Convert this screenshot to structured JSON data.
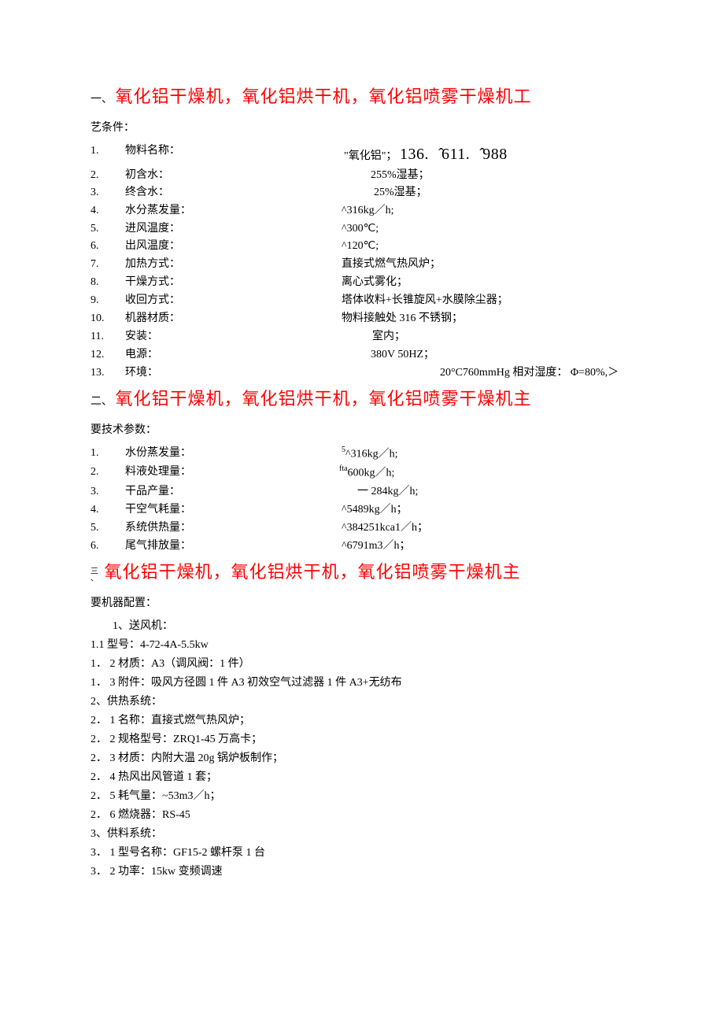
{
  "section1": {
    "prefix": "一、",
    "title": "氧化铝干燥机，氧化铝烘干机，氧化铝喷雾干燥机工",
    "subtitle": "艺条件：",
    "items": [
      {
        "num": "1.",
        "label": "物料名称：",
        "value_pre": "\"氧化铝\"；",
        "value_special": "136.一̂611.二̂988"
      },
      {
        "num": "2.",
        "label": "初含水：",
        "value": "255%湿基；"
      },
      {
        "num": "3.",
        "label": "终含水：",
        "value": "25%湿基；"
      },
      {
        "num": "4.",
        "label": "水分蒸发量：",
        "value": "^316kg／h;"
      },
      {
        "num": "5.",
        "label": "进风温度：",
        "value": "^300℃;"
      },
      {
        "num": "6.",
        "label": "出风温度：",
        "value": "^120℃;"
      },
      {
        "num": "7.",
        "label": "加热方式：",
        "value": "直接式燃气热风炉；"
      },
      {
        "num": "8.",
        "label": "干燥方式：",
        "value": "离心式雾化；"
      },
      {
        "num": "9.",
        "label": "收回方式：",
        "value": "塔体收料+长锥旋风+水膜除尘器；"
      },
      {
        "num": "10.",
        "label": "机器材质：",
        "value": "物料接触处 316 不锈钢；"
      },
      {
        "num": "11.",
        "label": "安装：",
        "value": "室内；"
      },
      {
        "num": "12.",
        "label": "电源：",
        "value": "380V    50HZ；"
      },
      {
        "num": "13.",
        "label": "环境：",
        "value": "20°C760mmHg 相对湿度： Φ=80%,＞"
      }
    ]
  },
  "section2": {
    "prefix": "二、",
    "title": "氧化铝干燥机，氧化铝烘干机，氧化铝喷雾干燥机主",
    "subtitle": "要技术参数：",
    "items": [
      {
        "num": "1.",
        "label": "水份蒸发量：",
        "sup": "5",
        "value": "^316kg／h;"
      },
      {
        "num": "2.",
        "label": "料液处理量：",
        "sup": "fta",
        "value": "600kg／h;"
      },
      {
        "num": "3.",
        "label": "干品产量：",
        "value": "一 284kg／h;"
      },
      {
        "num": "4.",
        "label": "干空气耗量：",
        "value": "^5489kg／h；"
      },
      {
        "num": "5.",
        "label": "系统供热量：",
        "value": "^384251kca1／h；"
      },
      {
        "num": "6.",
        "label": "尾气排放量：",
        "value": "^6791m3／h；"
      }
    ]
  },
  "section3": {
    "prefix": "三、",
    "title": "氧化铝干燥机，氧化铝烘干机，氧化铝喷雾干燥机主",
    "subtitle": "要机器配置：",
    "items": [
      "1、送风机：",
      "1.1 型号：4-72-4A-5.5kw",
      "1． 2 材质：A3（调风阀：1 件）",
      "1． 3 附件：吸风方径圆 1 件 A3 初效空气过滤器           1 件 A3+无纺布",
      "2、供热系统：",
      "2． 1 名称：直接式燃气热风炉；",
      "2． 2 规格型号：ZRQ1-45 万高卡；",
      "2． 3 材质：内附大温 20g 锅炉板制作；",
      "2． 4 热风出风管道 1 套；",
      "2． 5 耗气量：~53m3／h；",
      "2． 6 燃烧器：RS-45",
      "3、供料系统：",
      "3． 1 型号名称：GF15-2 螺杆泵 1 台",
      "3． 2 功率：15kw            变频调速"
    ]
  }
}
